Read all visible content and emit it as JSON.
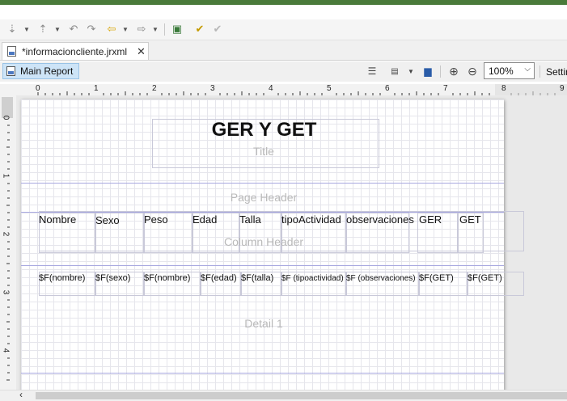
{
  "editor_tab": {
    "title": "*informacioncliente.jrxml",
    "close_glyph": "✕"
  },
  "toolbar": {
    "icons": [
      "export-icon",
      "import-icon",
      "undo-arrow-icon",
      "redo-arrow-icon",
      "back-icon",
      "forward-icon",
      "publish-icon",
      "checkmark-icon",
      "checkmark-gray-icon"
    ]
  },
  "report_toolbar": {
    "main_report_label": "Main Report",
    "zoom": "100%",
    "zoom_chevron": "⌵",
    "settings_label": "Settin"
  },
  "ruler": {
    "horizontal": [
      "0",
      "1",
      "2",
      "3",
      "4",
      "5",
      "6",
      "7",
      "8",
      "9"
    ],
    "vertical": [
      "0",
      "1",
      "2",
      "3",
      "4"
    ]
  },
  "report": {
    "title_text": "GER Y GET",
    "bands": {
      "title": "Title",
      "page_header": "Page Header",
      "column_header": "Column Header",
      "detail": "Detail 1"
    },
    "column_headers": [
      "Nombre",
      "Sexo",
      "Peso",
      "Edad",
      "Talla",
      "tipoActividad",
      "observaciones",
      "GER",
      "GET"
    ],
    "detail_fields": [
      "$F(nombre)",
      "$F(sexo)",
      "$F(nombre)",
      "$F(edad)",
      "$F(talla)",
      "$F (tipoactividad)",
      "$F (observaciones)",
      "$F(GET)",
      "$F(GET)"
    ]
  }
}
